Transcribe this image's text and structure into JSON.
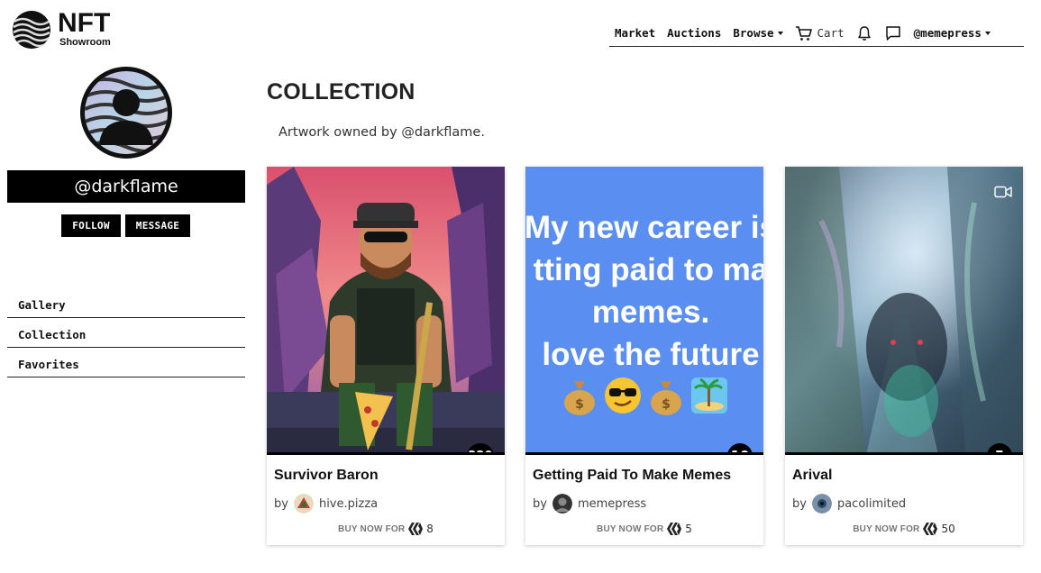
{
  "brand": {
    "name": "NFT",
    "subtitle": "Showroom"
  },
  "nav": {
    "market": "Market",
    "auctions": "Auctions",
    "browse": "Browse",
    "cart": "Cart",
    "user": "@memepress"
  },
  "profile": {
    "username": "@darkflame",
    "follow_label": "FOLLOW",
    "message_label": "MESSAGE"
  },
  "side_menu": [
    {
      "label": "Gallery"
    },
    {
      "label": "Collection"
    },
    {
      "label": "Favorites"
    }
  ],
  "page": {
    "title": "COLLECTION",
    "subtitle": "Artwork owned by @darkflame."
  },
  "cards": [
    {
      "title": "Survivor Baron",
      "by_label": "by",
      "author": "hive.pizza",
      "buy_label": "BUY NOW FOR",
      "price": "8",
      "count": "220",
      "media": "image"
    },
    {
      "title": "Getting Paid To Make Memes",
      "by_label": "by",
      "author": "memepress",
      "buy_label": "BUY NOW FOR",
      "price": "5",
      "count": "10",
      "media": "image",
      "meme_lines": [
        "My new career is",
        "tting paid to ma",
        "memes.",
        "love the future"
      ]
    },
    {
      "title": "Arival",
      "by_label": "by",
      "author": "pacolimited",
      "buy_label": "BUY NOW FOR",
      "price": "50",
      "count": "5",
      "media": "video"
    }
  ],
  "colors": {
    "accent": "#000000",
    "meme_bg": "#5a8ef0"
  },
  "icons": [
    "logo-icon",
    "cart-icon",
    "bell-icon",
    "chat-icon",
    "hive-icon",
    "video-icon",
    "user-avatar-icon"
  ]
}
